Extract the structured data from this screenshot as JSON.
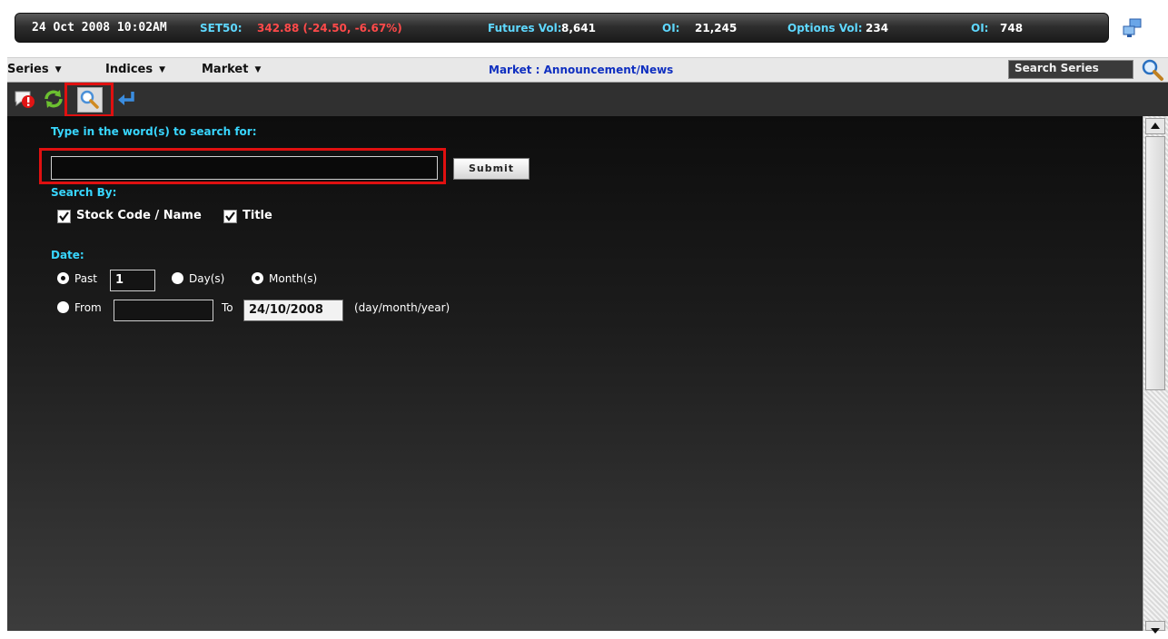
{
  "ticker": {
    "datetime": "24 Oct 2008 10:02AM",
    "set50_label": "SET50:",
    "set50_value": "342.88 (-24.50, -6.67%)",
    "futures_vol_label": "Futures Vol:",
    "futures_vol_value": "8,641",
    "futures_oi_label": "OI:",
    "futures_oi_value": "21,245",
    "options_vol_label": "Options Vol:",
    "options_vol_value": "234",
    "options_oi_label": "OI:",
    "options_oi_value": "748"
  },
  "menubar": {
    "series": "Series",
    "indices": "Indices",
    "market": "Market",
    "page_heading": "Market : Announcement/News",
    "search_series_value": "Search Series"
  },
  "toolbar": {
    "icons": [
      "alert-icon",
      "refresh-icon",
      "search-icon",
      "back-arrow-icon"
    ],
    "selected": "search-icon"
  },
  "form": {
    "keyword_prompt": "Type in the word(s) to search for:",
    "keyword_value": "",
    "submit_label": "Submit",
    "search_by_label": "Search By:",
    "stock_code_label": "Stock Code / Name",
    "stock_code_checked": true,
    "title_label": "Title",
    "title_checked": true,
    "date_label": "Date:",
    "past_label": "Past",
    "past_value": "1",
    "days_label": "Day(s)",
    "months_label": "Month(s)",
    "from_label": "From",
    "from_value": "",
    "to_label": "To",
    "to_value": "24/10/2008",
    "date_format_hint": "(day/month/year)",
    "selected_range": "past",
    "selected_unit": "month"
  },
  "colors": {
    "cyan": "#38d6ff",
    "negative": "#ff4a4a",
    "highlight_frame": "#e01010",
    "heading_blue": "#1030c0"
  }
}
